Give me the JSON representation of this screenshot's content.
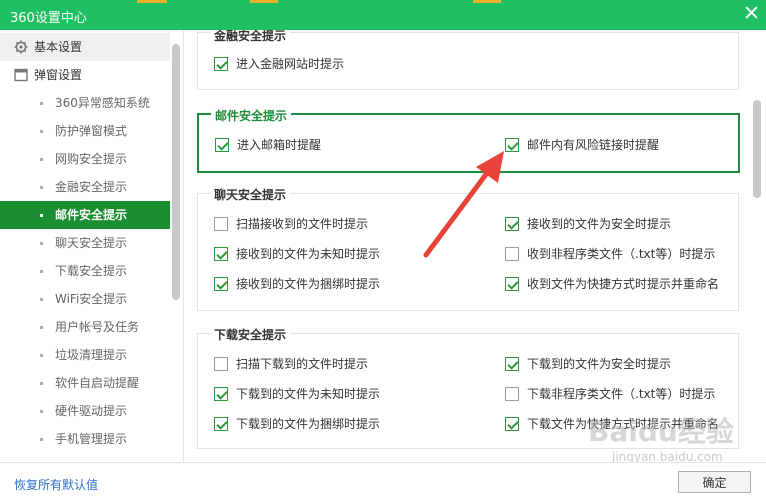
{
  "window": {
    "title": "360设置中心"
  },
  "colors": {
    "brand": "#1fbf63",
    "active": "#1a8f2f",
    "highlight": "#1d8d3a",
    "arrow": "#e8433a",
    "link": "#2a6fc9"
  },
  "sidebar": {
    "sections": [
      {
        "label": "基本设置",
        "icon": "gear-icon"
      },
      {
        "label": "弹窗设置",
        "icon": "window-icon"
      }
    ],
    "items": [
      {
        "label": "360异常感知系统"
      },
      {
        "label": "防护弹窗模式"
      },
      {
        "label": "网购安全提示"
      },
      {
        "label": "金融安全提示"
      },
      {
        "label": "邮件安全提示",
        "active": true
      },
      {
        "label": "聊天安全提示"
      },
      {
        "label": "下载安全提示"
      },
      {
        "label": "WiFi安全提示"
      },
      {
        "label": "用户帐号及任务"
      },
      {
        "label": "垃圾清理提示"
      },
      {
        "label": "软件自启动提醒"
      },
      {
        "label": "硬件驱动提示"
      },
      {
        "label": "手机管理提示"
      }
    ]
  },
  "groups": {
    "finance": {
      "title": "金融安全提示",
      "options": [
        {
          "label": "进入金融网站时提示",
          "checked": true
        }
      ]
    },
    "mail": {
      "title": "邮件安全提示",
      "options": [
        {
          "label": "进入邮箱时提醒",
          "checked": true
        },
        {
          "label": "邮件内有风险链接时提醒",
          "checked": true
        }
      ]
    },
    "chat": {
      "title": "聊天安全提示",
      "options": [
        {
          "label": "扫描接收到的文件时提示",
          "checked": false
        },
        {
          "label": "接收到的文件为安全时提示",
          "checked": true
        },
        {
          "label": "接收到的文件为未知时提示",
          "checked": true
        },
        {
          "label": "收到非程序类文件（.txt等）时提示",
          "checked": false
        },
        {
          "label": "接收到的文件为捆绑时提示",
          "checked": true
        },
        {
          "label": "收到文件为快捷方式时提示并重命名",
          "checked": true
        }
      ]
    },
    "download": {
      "title": "下载安全提示",
      "options": [
        {
          "label": "扫描下载到的文件时提示",
          "checked": false
        },
        {
          "label": "下载到的文件为安全时提示",
          "checked": true
        },
        {
          "label": "下载到的文件为未知时提示",
          "checked": true
        },
        {
          "label": "下载非程序类文件（.txt等）时提示",
          "checked": false
        },
        {
          "label": "下载到的文件为捆绑时提示",
          "checked": true
        },
        {
          "label": "下载文件为快捷方式时提示并重命名",
          "checked": true
        }
      ]
    }
  },
  "footer": {
    "restore_label": "恢复所有默认值",
    "ok_label": "确定"
  },
  "watermark": {
    "main": "Baidu经验",
    "sub": "jingyan.baidu.com"
  }
}
